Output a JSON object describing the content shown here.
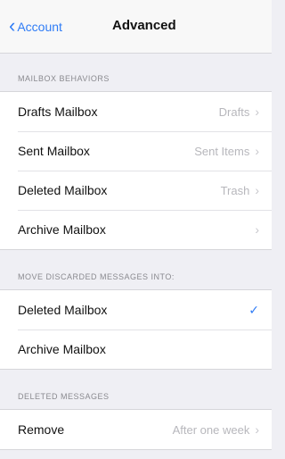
{
  "nav": {
    "back_label": "Account",
    "title": "Advanced"
  },
  "sections": {
    "mailbox_behaviors": {
      "header": "MAILBOX BEHAVIORS",
      "rows": [
        {
          "label": "Drafts Mailbox",
          "value": "Drafts"
        },
        {
          "label": "Sent Mailbox",
          "value": "Sent Items"
        },
        {
          "label": "Deleted Mailbox",
          "value": "Trash"
        },
        {
          "label": "Archive Mailbox",
          "value": ""
        }
      ]
    },
    "move_discarded": {
      "header": "MOVE DISCARDED MESSAGES INTO:",
      "rows": [
        {
          "label": "Deleted Mailbox",
          "selected": true
        },
        {
          "label": "Archive Mailbox",
          "selected": false
        }
      ]
    },
    "deleted_messages": {
      "header": "DELETED MESSAGES",
      "rows": [
        {
          "label": "Remove",
          "value": "After one week"
        }
      ]
    }
  },
  "colors": {
    "accent": "#2f7cf6",
    "background": "#efeff4"
  }
}
